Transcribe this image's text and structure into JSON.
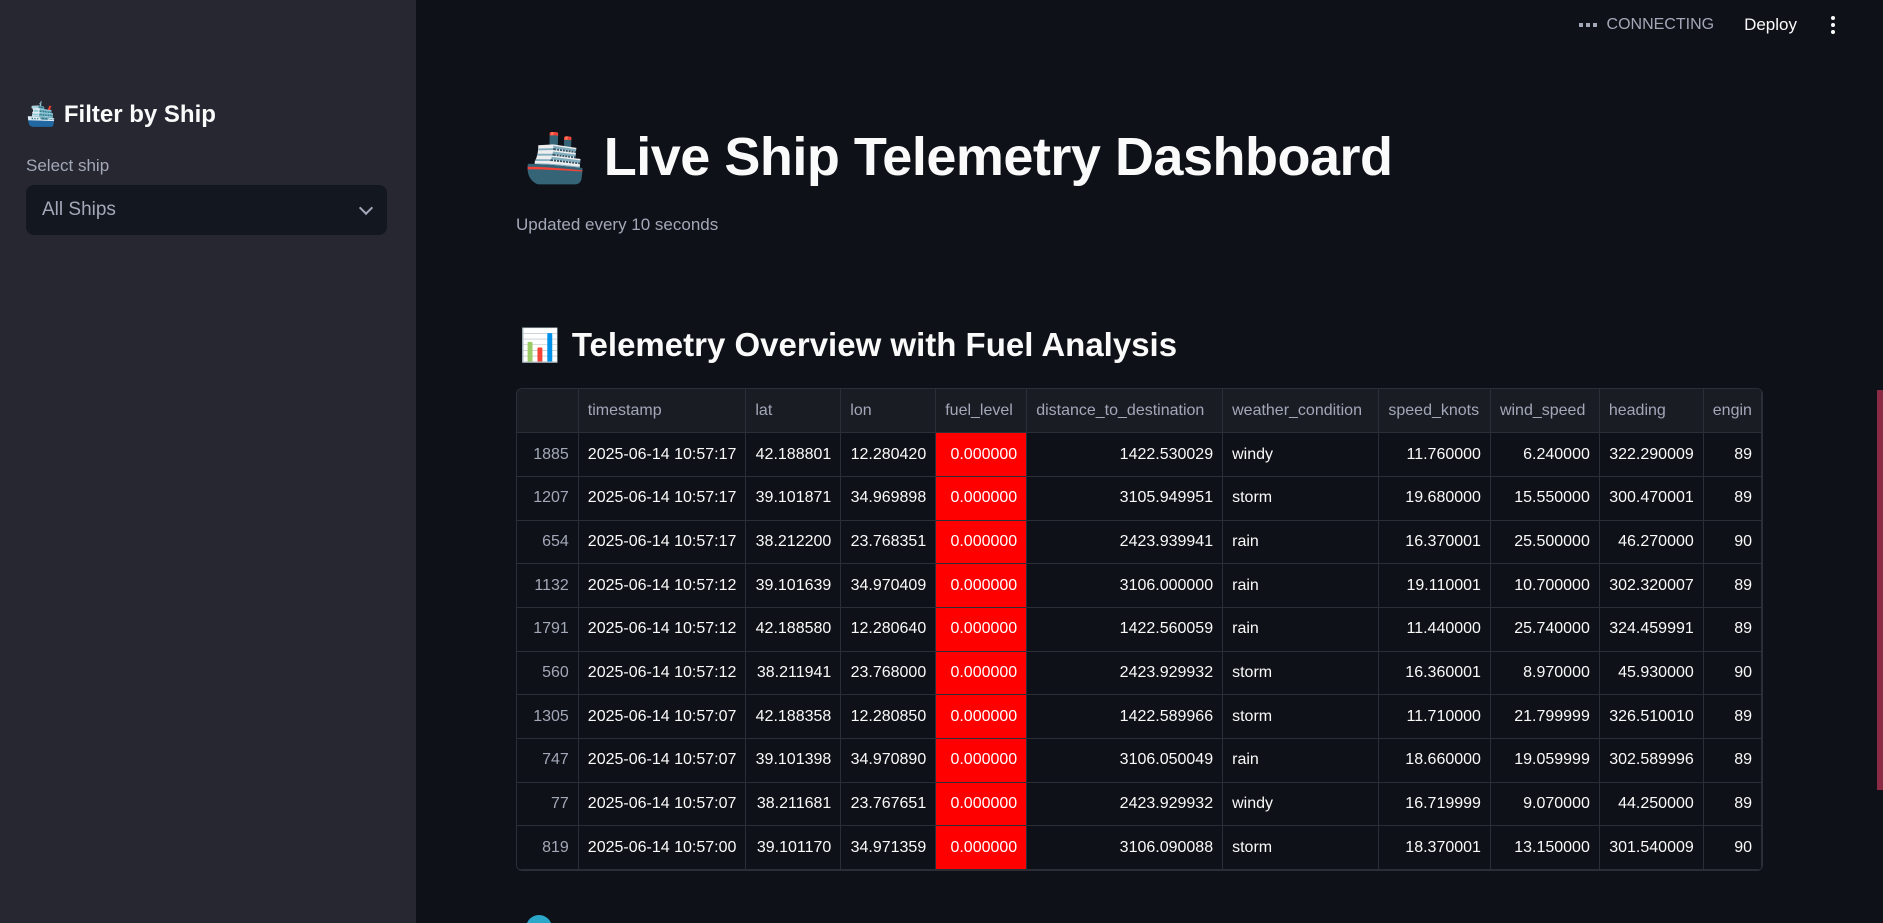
{
  "header": {
    "status": "CONNECTING",
    "deploy_label": "Deploy",
    "menu_icon": "kebab-menu-icon"
  },
  "sidebar": {
    "title": "Filter by Ship",
    "title_icon": "🛳️",
    "select_label": "Select ship",
    "select_value": "All Ships"
  },
  "main": {
    "title": "Live Ship Telemetry Dashboard",
    "title_icon": "🚢",
    "caption": "Updated every 10 seconds",
    "section_title": "Telemetry Overview with Fuel Analysis",
    "section_icon": "📊"
  },
  "table": {
    "columns": [
      "",
      "timestamp",
      "lat",
      "lon",
      "fuel_level",
      "distance_to_destination",
      "weather_condition",
      "speed_knots",
      "wind_speed",
      "heading",
      "engin"
    ],
    "rows": [
      [
        "1885",
        "2025-06-14 10:57:17",
        "42.188801",
        "12.280420",
        "0.000000",
        "1422.530029",
        "windy",
        "11.760000",
        "6.240000",
        "322.290009",
        "89"
      ],
      [
        "1207",
        "2025-06-14 10:57:17",
        "39.101871",
        "34.969898",
        "0.000000",
        "3105.949951",
        "storm",
        "19.680000",
        "15.550000",
        "300.470001",
        "89"
      ],
      [
        "654",
        "2025-06-14 10:57:17",
        "38.212200",
        "23.768351",
        "0.000000",
        "2423.939941",
        "rain",
        "16.370001",
        "25.500000",
        "46.270000",
        "90"
      ],
      [
        "1132",
        "2025-06-14 10:57:12",
        "39.101639",
        "34.970409",
        "0.000000",
        "3106.000000",
        "rain",
        "19.110001",
        "10.700000",
        "302.320007",
        "89"
      ],
      [
        "1791",
        "2025-06-14 10:57:12",
        "42.188580",
        "12.280640",
        "0.000000",
        "1422.560059",
        "rain",
        "11.440000",
        "25.740000",
        "324.459991",
        "89"
      ],
      [
        "560",
        "2025-06-14 10:57:12",
        "38.211941",
        "23.768000",
        "0.000000",
        "2423.929932",
        "storm",
        "16.360001",
        "8.970000",
        "45.930000",
        "90"
      ],
      [
        "1305",
        "2025-06-14 10:57:07",
        "42.188358",
        "12.280850",
        "0.000000",
        "1422.589966",
        "storm",
        "11.710000",
        "21.799999",
        "326.510010",
        "89"
      ],
      [
        "747",
        "2025-06-14 10:57:07",
        "39.101398",
        "34.970890",
        "0.000000",
        "3106.050049",
        "rain",
        "18.660000",
        "19.059999",
        "302.589996",
        "89"
      ],
      [
        "77",
        "2025-06-14 10:57:07",
        "38.211681",
        "23.767651",
        "0.000000",
        "2423.929932",
        "windy",
        "16.719999",
        "9.070000",
        "44.250000",
        "89"
      ],
      [
        "819",
        "2025-06-14 10:57:00",
        "39.101170",
        "34.971359",
        "0.000000",
        "3106.090088",
        "storm",
        "18.370001",
        "13.150000",
        "301.540009",
        "90"
      ]
    ],
    "highlight_color": "#ff0000"
  }
}
